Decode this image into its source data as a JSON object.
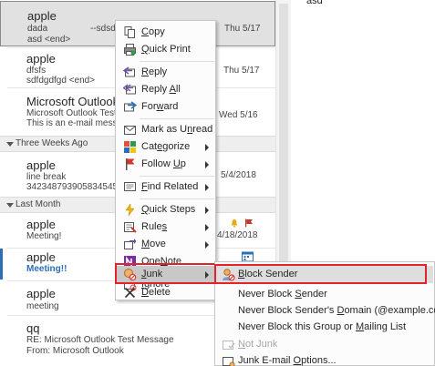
{
  "messages": [
    {
      "from": "apple",
      "line1": "dada",
      "line1b": "--sdsdfs",
      "line2": "asd <end>",
      "date": "Thu 5/17"
    },
    {
      "from": "apple",
      "line1": "dfsfs",
      "line2": "sdfdgdfgd <end>",
      "date": "Thu 5/17"
    },
    {
      "from": "Microsoft Outlook",
      "line1": "Microsoft Outlook Test M",
      "line2": "This is an e-mail message",
      "date": "Wed 5/16"
    },
    {
      "from": "apple",
      "line1": "line break",
      "line2": "34234879390583454564",
      "date": "5/4/2018"
    },
    {
      "from": "apple",
      "line1": "Meeting!",
      "date": "4/18/2018"
    },
    {
      "from": "apple",
      "line1": "Meeting!!"
    },
    {
      "from": "apple",
      "line1": "meeting"
    },
    {
      "from": "qq",
      "line1": "RE: Microsoft Outlook Test Message",
      "line2": "From: Microsoft Outlook"
    }
  ],
  "groups": {
    "three_weeks": "Three Weeks Ago",
    "last_month": "Last Month"
  },
  "reading_pane": {
    "text": "asd"
  },
  "context_menu": {
    "copy": {
      "pre": "",
      "key": "C",
      "post": "opy"
    },
    "quick_print": {
      "pre": "",
      "key": "Q",
      "post": "uick Print"
    },
    "reply": {
      "pre": "",
      "key": "R",
      "post": "eply"
    },
    "reply_all": {
      "pre": "Reply ",
      "key": "A",
      "post": "ll"
    },
    "forward": {
      "pre": "For",
      "key": "w",
      "post": "ard"
    },
    "mark_unread": {
      "pre": "Mark as U",
      "key": "n",
      "post": "read"
    },
    "categorize": {
      "pre": "Cat",
      "key": "e",
      "post": "gorize"
    },
    "follow_up": {
      "pre": "Follow ",
      "key": "U",
      "post": "p"
    },
    "find_related": {
      "pre": "",
      "key": "F",
      "post": "ind Related"
    },
    "quick_steps": {
      "pre": "",
      "key": "Q",
      "post": "uick Steps"
    },
    "rules": {
      "pre": "Rule",
      "key": "s",
      "post": ""
    },
    "move": {
      "pre": "",
      "key": "M",
      "post": "ove"
    },
    "onenote": {
      "pre": "One",
      "key": "N",
      "post": "ote"
    },
    "ignore": {
      "pre": "",
      "key": "I",
      "post": "gnore"
    },
    "junk": {
      "pre": "",
      "key": "J",
      "post": "unk"
    },
    "delete": {
      "pre": "",
      "key": "D",
      "post": "elete"
    }
  },
  "junk_submenu": {
    "block_sender": {
      "pre": "",
      "key": "B",
      "post": "lock Sender"
    },
    "never_block_sender": {
      "pre": "Never Block ",
      "key": "S",
      "post": "ender"
    },
    "never_block_domain": {
      "pre": "Never Block Sender's ",
      "key": "D",
      "post": "omain (@example.com)"
    },
    "never_block_group": {
      "pre": "Never Block this Group or ",
      "key": "M",
      "post": "ailing List"
    },
    "not_junk": {
      "pre": "",
      "key": "N",
      "post": "ot Junk"
    },
    "junk_options": {
      "pre": "Junk E-mail ",
      "key": "O",
      "post": "ptions..."
    }
  },
  "colors": {
    "accent": "#2b6fb7",
    "highlight_box": "#e0242c",
    "flag": "#c0392b"
  }
}
